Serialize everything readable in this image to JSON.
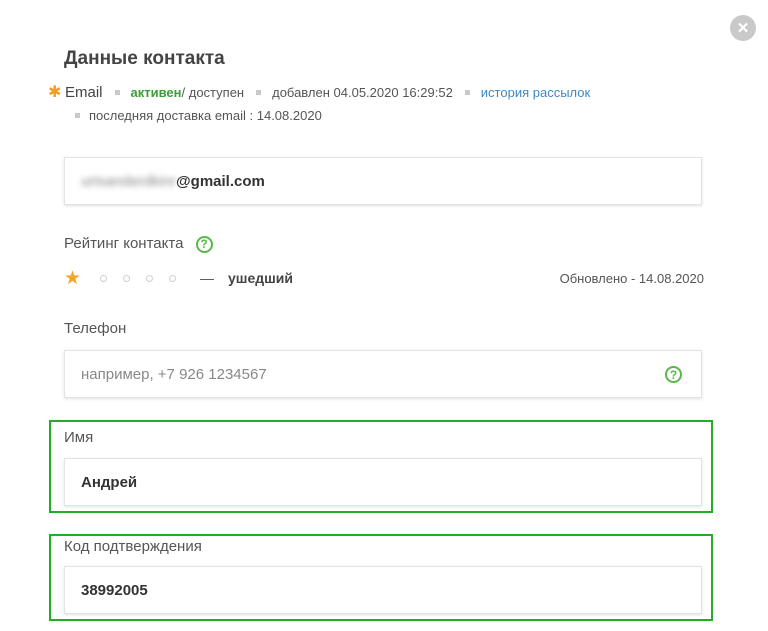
{
  "dialog": {
    "close_symbol": "✕",
    "title": "Данные контакта"
  },
  "channel": {
    "required_mark": "✱",
    "name": "Email",
    "status_active": "активен",
    "status_separator": " / доступен",
    "added": "добавлен 04.05.2020 16:29:52",
    "history_link": "история рассылок",
    "last_delivery": "последняя доставка email : 14.08.2020"
  },
  "email_field": {
    "value_hidden": "urisanderdkinr",
    "value_domain": "@gmail.com"
  },
  "rating": {
    "label": "Рейтинг контакта",
    "help_symbol": "?",
    "stars_filled": 1,
    "stars_total": 5,
    "dash": "—",
    "value_text": "ушедший",
    "updated": "Обновлено - 14.08.2020"
  },
  "phone": {
    "label": "Телефон",
    "placeholder": "например, +7 926 1234567",
    "help_symbol": "?"
  },
  "name_field": {
    "label": "Имя",
    "value": "Андрей"
  },
  "code_field": {
    "label": "Код подтверждения",
    "value": "38992005"
  },
  "colors": {
    "highlight": "#22ad22",
    "active": "#3aa035",
    "link": "#3d89c4",
    "star": "#f5a623"
  }
}
